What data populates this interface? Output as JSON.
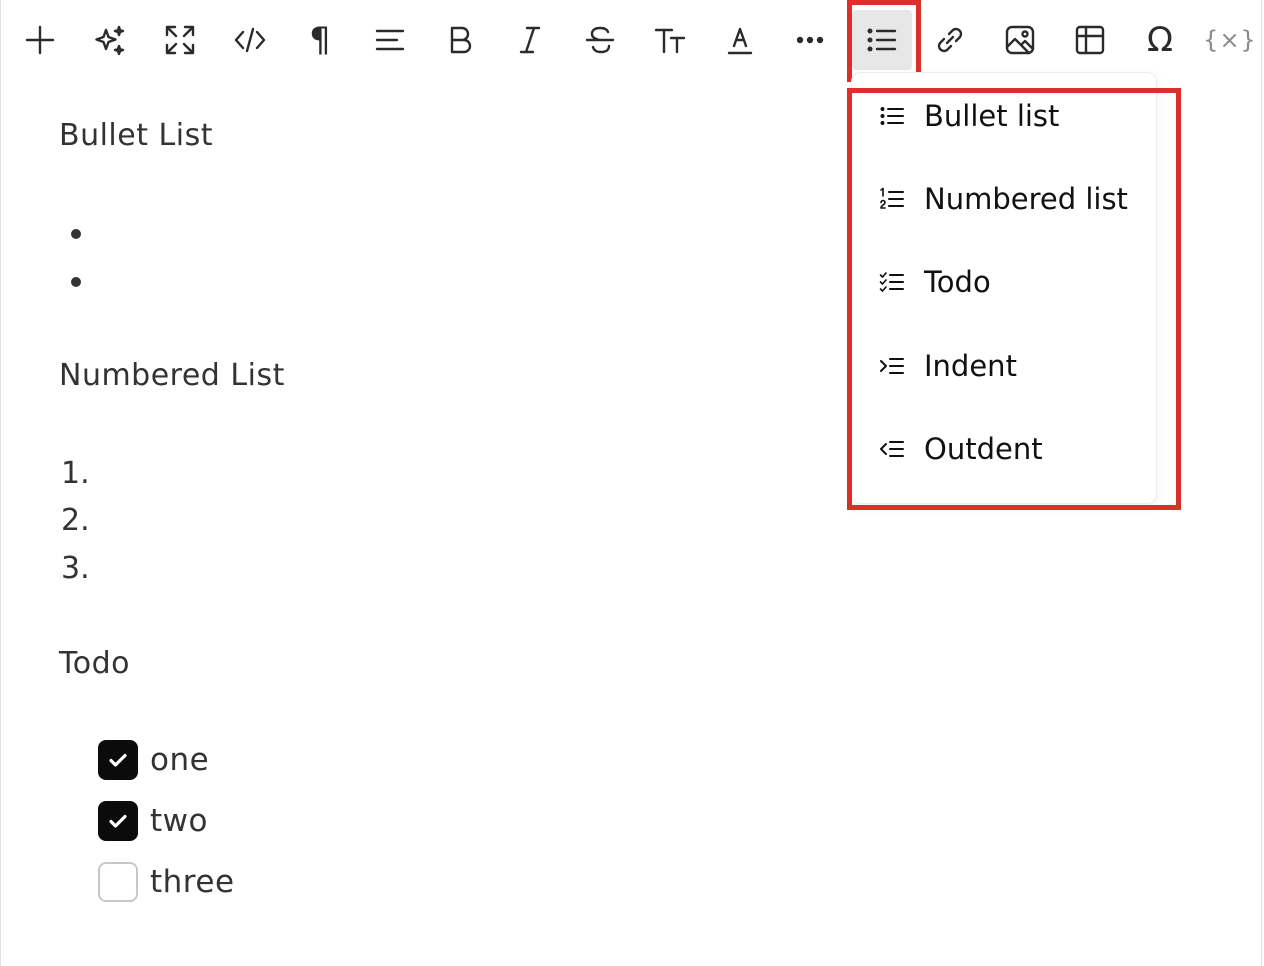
{
  "toolbar": {
    "tools": [
      {
        "name": "insert",
        "icon": "plus-icon"
      },
      {
        "name": "ai",
        "icon": "sparkles-icon"
      },
      {
        "name": "fullscreen",
        "icon": "expand-icon"
      },
      {
        "name": "code",
        "icon": "code-icon"
      },
      {
        "name": "paragraph",
        "icon": "pilcrow-icon"
      },
      {
        "name": "align",
        "icon": "align-left-icon"
      },
      {
        "name": "bold",
        "icon": "bold-icon"
      },
      {
        "name": "italic",
        "icon": "italic-icon"
      },
      {
        "name": "strikethrough",
        "icon": "strikethrough-icon"
      },
      {
        "name": "font-size",
        "icon": "text-size-icon"
      },
      {
        "name": "font-color",
        "icon": "font-color-icon"
      },
      {
        "name": "more",
        "icon": "more-icon"
      },
      {
        "name": "list",
        "icon": "list-icon",
        "active": true
      },
      {
        "name": "link",
        "icon": "link-icon"
      },
      {
        "name": "image",
        "icon": "image-icon"
      },
      {
        "name": "table",
        "icon": "table-icon"
      },
      {
        "name": "special-char",
        "icon": "omega-icon"
      },
      {
        "name": "variable",
        "icon": "variable-icon"
      }
    ],
    "highlight_color": "#d9302a"
  },
  "content": {
    "bullet_heading": "Bullet List",
    "numbered_heading": "Numbered List",
    "numbers": [
      "1.",
      "2.",
      "3."
    ],
    "todo_heading": "Todo",
    "todos": [
      {
        "label": "one",
        "checked": true
      },
      {
        "label": "two",
        "checked": true
      },
      {
        "label": "three",
        "checked": false
      }
    ]
  },
  "list_menu": {
    "items": [
      {
        "label": "Bullet list",
        "icon": "bullet-list-icon"
      },
      {
        "label": "Numbered list",
        "icon": "numbered-list-icon"
      },
      {
        "label": "Todo",
        "icon": "todo-list-icon"
      },
      {
        "label": "Indent",
        "icon": "indent-icon"
      },
      {
        "label": "Outdent",
        "icon": "outdent-icon"
      }
    ]
  }
}
